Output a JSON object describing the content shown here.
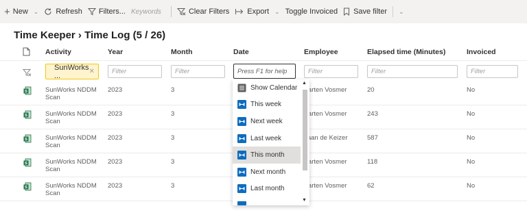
{
  "toolbar": {
    "new_label": "New",
    "refresh_label": "Refresh",
    "filters_label": "Filters...",
    "keywords_placeholder": "Keywords",
    "clear_filters_label": "Clear Filters",
    "export_label": "Export",
    "toggle_invoiced_label": "Toggle Invoiced",
    "save_filter_label": "Save filter"
  },
  "page": {
    "title": "Time Keeper › Time Log (5 / 26)"
  },
  "grid": {
    "columns": [
      "Activity",
      "Year",
      "Month",
      "Date",
      "Employee",
      "Elapsed time (Minutes)",
      "Invoiced"
    ],
    "filters": {
      "activity_chip": "SunWorks ...",
      "year_placeholder": "Filter",
      "month_placeholder": "Filter",
      "date_placeholder": "Press F1 for help",
      "employee_placeholder": "Filter",
      "elapsed_placeholder": "Filter",
      "invoiced_placeholder": "Filter"
    },
    "rows": [
      {
        "activity_line1": "SunWorks NDDM",
        "activity_line2": "Scan",
        "year": "2023",
        "month": "3",
        "employee": "Marten Vosmer",
        "elapsed": "20",
        "invoiced": "No"
      },
      {
        "activity_line1": "SunWorks NDDM",
        "activity_line2": "Scan",
        "year": "2023",
        "month": "3",
        "employee": "Marten Vosmer",
        "elapsed": "243",
        "invoiced": "No"
      },
      {
        "activity_line1": "SunWorks NDDM",
        "activity_line2": "Scan",
        "year": "2023",
        "month": "3",
        "employee": "Daan de Keizer",
        "elapsed": "587",
        "invoiced": "No"
      },
      {
        "activity_line1": "SunWorks NDDM",
        "activity_line2": "Scan",
        "year": "2023",
        "month": "3",
        "employee": "Marten Vosmer",
        "elapsed": "118",
        "invoiced": "No"
      },
      {
        "activity_line1": "SunWorks NDDM",
        "activity_line2": "Scan",
        "year": "2023",
        "month": "3",
        "employee": "Marten Vosmer",
        "elapsed": "62",
        "invoiced": "No"
      }
    ]
  },
  "date_dropdown": {
    "items": [
      "Show Calendar",
      "This week",
      "Next week",
      "Last week",
      "This month",
      "Next month",
      "Last month"
    ],
    "selected": "This month"
  },
  "colors": {
    "accent": "#0f6cbd",
    "chip_border": "#f2c811",
    "chip_bg": "#fff4ce",
    "excel_green": "#217346"
  }
}
